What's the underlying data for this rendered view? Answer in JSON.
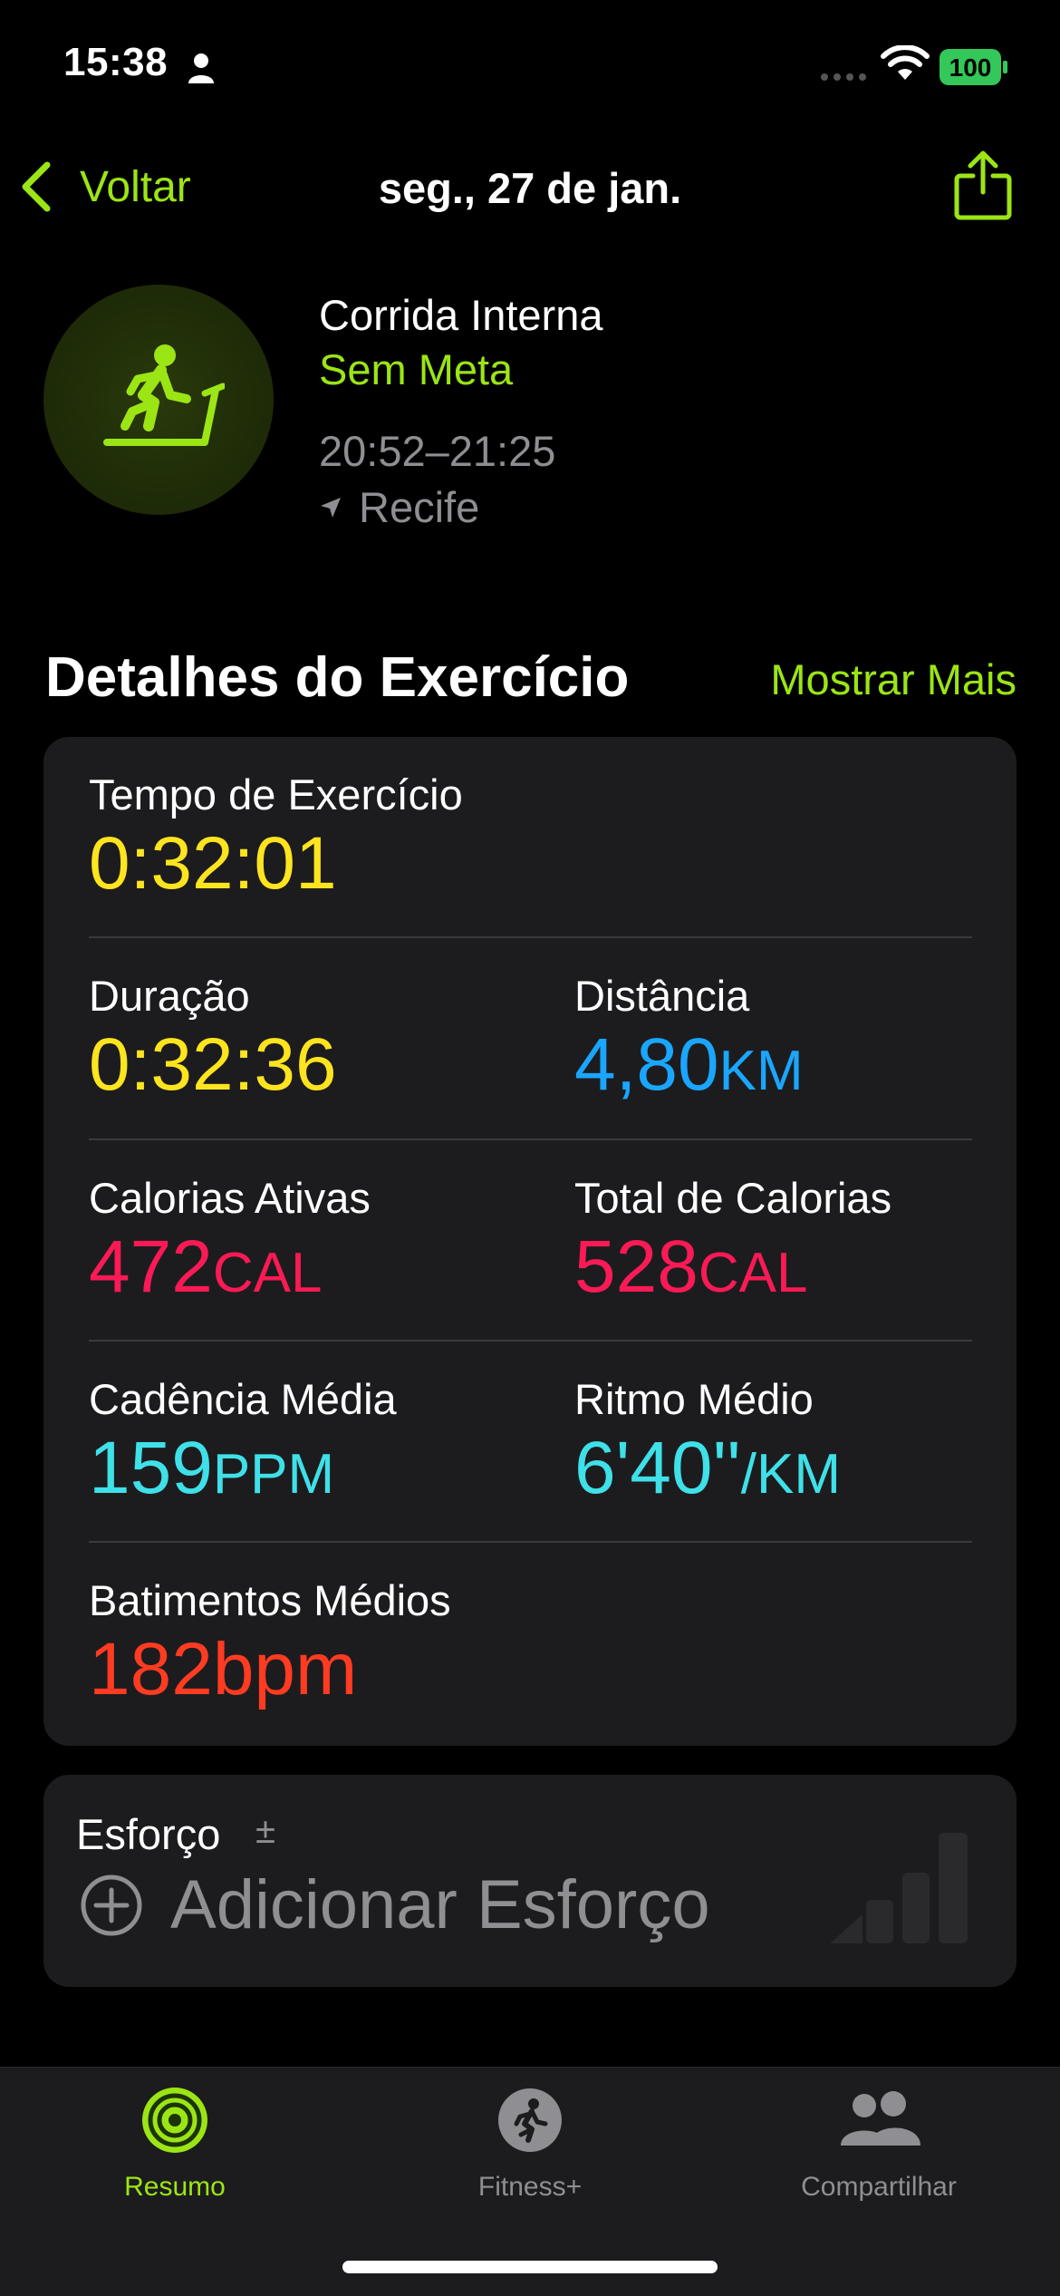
{
  "status_bar": {
    "time": "15:38",
    "battery": "100"
  },
  "nav": {
    "back_label": "Voltar",
    "title": "seg., 27 de jan."
  },
  "workout": {
    "type": "Corrida Interna",
    "goal": "Sem Meta",
    "time_range": "20:52–21:25",
    "location": "Recife"
  },
  "section": {
    "title": "Detalhes do Exercício",
    "more_label": "Mostrar Mais"
  },
  "metrics": {
    "exercise_time": {
      "label": "Tempo de Exercício",
      "value": "0:32:01",
      "color": "#fde41f"
    },
    "duration": {
      "label": "Duração",
      "value": "0:32:36",
      "color": "#fde41f"
    },
    "distance": {
      "label": "Distância",
      "value": "4,80",
      "unit": "KM",
      "color": "#1aa6ff"
    },
    "active_calories": {
      "label": "Calorias Ativas",
      "value": "472",
      "unit": "CAL",
      "color": "#fa1a55"
    },
    "total_calories": {
      "label": "Total de Calorias",
      "value": "528",
      "unit": "CAL",
      "color": "#fa1a55"
    },
    "avg_cadence": {
      "label": "Cadência Média",
      "value": "159",
      "unit": "PPM",
      "color": "#3fe0e8"
    },
    "avg_pace": {
      "label": "Ritmo Médio",
      "value": "6'40''",
      "unit": "/KM",
      "color": "#3fe0e8"
    },
    "avg_heart_rate": {
      "label": "Batimentos Médios",
      "value": "182bpm",
      "color": "#ff3b22"
    }
  },
  "effort": {
    "label": "Esforço",
    "symbol": "±",
    "add_label": "Adicionar Esforço"
  },
  "tabs": [
    {
      "label": "Resumo",
      "icon": "activity-rings-icon",
      "active": true
    },
    {
      "label": "Fitness+",
      "icon": "fitness-plus-icon",
      "active": false
    },
    {
      "label": "Compartilhar",
      "icon": "sharing-icon",
      "active": false
    }
  ],
  "colors": {
    "accent": "#9be515",
    "background": "#000000",
    "card": "#1c1c1e",
    "secondary_text": "#8e8e93"
  }
}
